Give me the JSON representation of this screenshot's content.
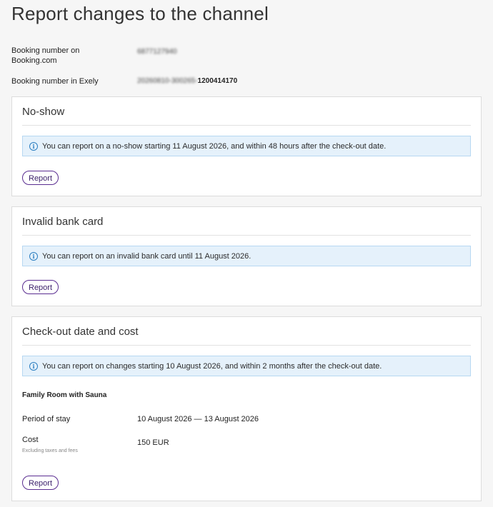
{
  "page": {
    "title": "Report changes to the channel"
  },
  "booking": {
    "booking_com_label": "Booking number on Booking.com",
    "booking_com_value": "6877127940",
    "exely_label": "Booking number in Exely",
    "exely_value_prefix": "20260810-300265-",
    "exely_value_suffix": "1200414170"
  },
  "sections": {
    "no_show": {
      "title": "No-show",
      "info": "You can report on a no-show starting 11 August 2026, and within 48 hours after the check-out date.",
      "button": "Report"
    },
    "invalid_card": {
      "title": "Invalid bank card",
      "info": "You can report on an invalid bank card until 11 August 2026.",
      "button": "Report"
    },
    "checkout": {
      "title": "Check-out date and cost",
      "info": "You can report on changes starting 10 August 2026, and within 2 months after the check-out date.",
      "room_name": "Family Room with Sauna",
      "period_label": "Period of stay",
      "period_value": "10 August 2026 — 13 August 2026",
      "cost_label": "Cost",
      "cost_sublabel": "Excluding taxes and fees",
      "cost_value": "150 EUR",
      "button": "Report"
    }
  },
  "icons": {
    "info": "info-circle-icon"
  },
  "colors": {
    "accent": "#5a2d91",
    "info_bg": "#e5f1fb",
    "info_border": "#b7d8f2",
    "info_icon": "#2d7fc1"
  }
}
